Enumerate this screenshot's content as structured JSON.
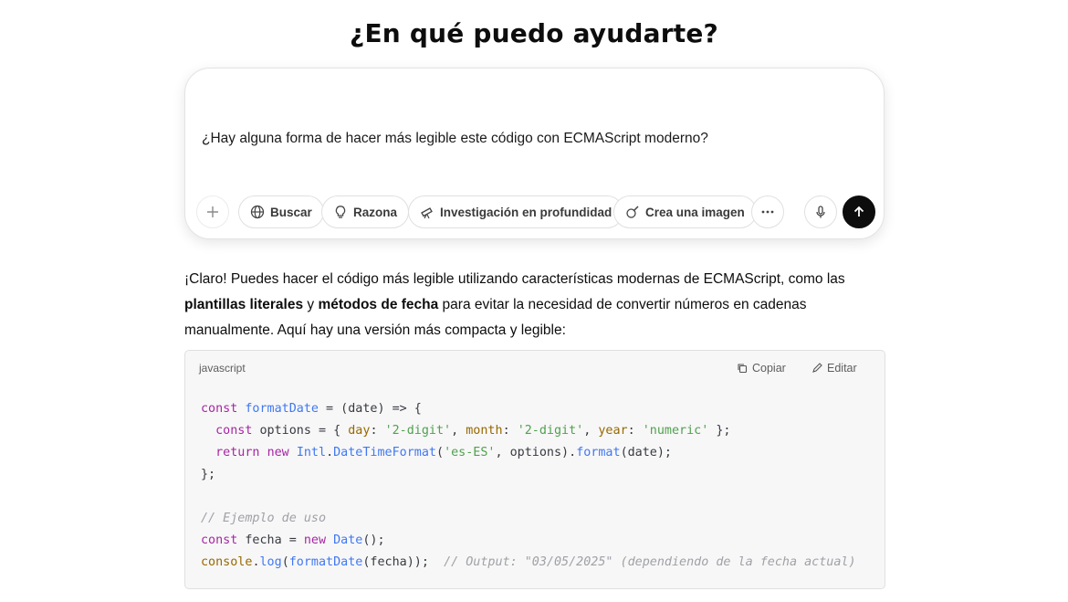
{
  "heading": "¿En qué puedo ayudarte?",
  "composer": {
    "prompt": "¿Hay alguna forma de hacer más legible este código con ECMAScript moderno?",
    "tools": {
      "search": "Buscar",
      "reason": "Razona",
      "research": "Investigación en profundidad",
      "image": "Crea una imagen"
    },
    "icons": [
      "plus-icon",
      "globe-icon",
      "lightbulb-icon",
      "telescope-icon",
      "paint-brush-icon",
      "more-icon",
      "microphone-icon",
      "arrow-up-icon"
    ]
  },
  "answer": {
    "p1": "¡Claro! Puedes hacer el código más legible utilizando características modernas de ECMAScript, como las",
    "bold1": "plantillas literales",
    "mid": " y ",
    "bold2": "métodos de fecha",
    "p2": " para evitar la necesidad de convertir números en cadenas",
    "p3": "manualmente. Aquí hay una versión más compacta y legible:"
  },
  "code": {
    "language": "javascript",
    "copy_label": "Copiar",
    "edit_label": "Editar",
    "lines": [
      "const formatDate = (date) => {",
      "  const options = { day: '2-digit', month: '2-digit', year: 'numeric' };",
      "  return new Intl.DateTimeFormat('es-ES', options).format(date);",
      "};",
      "",
      "// Ejemplo de uso",
      "const fecha = new Date();",
      "console.log(formatDate(fecha));  // Output: \"03/05/2025\" (dependiendo de la fecha actual)"
    ]
  }
}
